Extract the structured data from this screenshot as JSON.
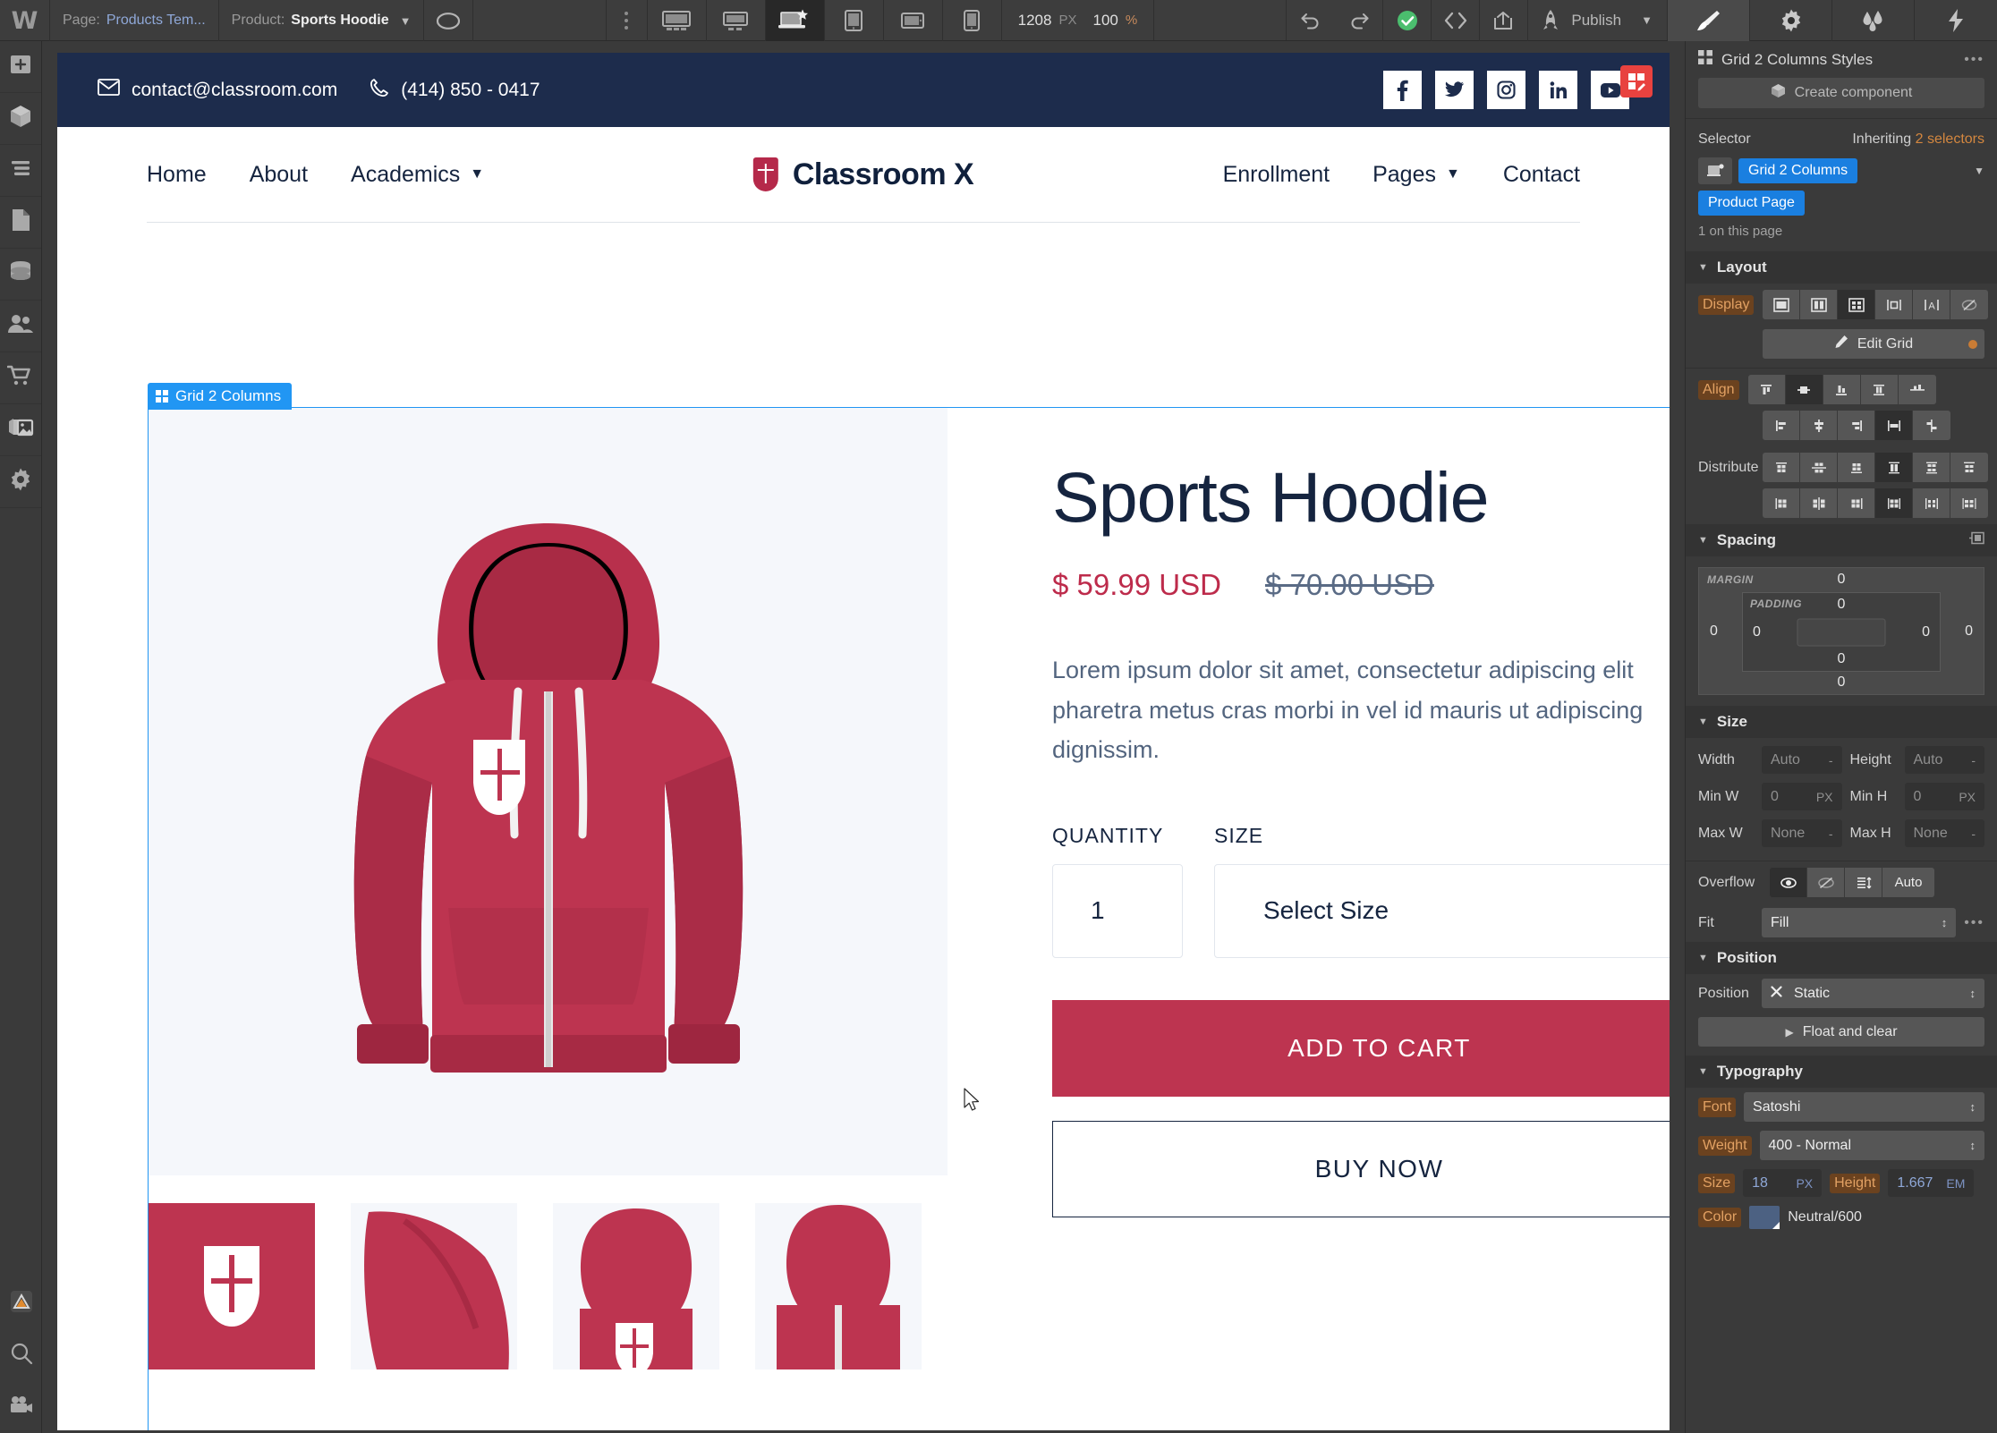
{
  "topbar": {
    "logo": "webflow-logo-icon",
    "page_label": "Page:",
    "page_value": "Products Tem...",
    "product_label": "Product:",
    "product_value": "Sports Hoodie",
    "preview_icon": "eye-preview-icon",
    "menu_icon": "kebab-menu-icon",
    "breakpoints": [
      "desktop-xl-icon",
      "desktop-icon",
      "laptop-starred-icon",
      "tablet-icon",
      "tablet-landscape-icon",
      "mobile-icon"
    ],
    "active_breakpoint_index": 2,
    "canvas_width": "1208",
    "canvas_width_unit": "PX",
    "zoom_value": "100",
    "zoom_unit": "%",
    "undo_icon": "undo-icon",
    "redo_icon": "redo-icon",
    "status_icon": "saved-check-icon",
    "code_icon": "code-brackets-icon",
    "export_icon": "share-export-icon",
    "rocket_icon": "rocket-icon",
    "publish_label": "Publish",
    "panel_tabs": [
      "paintbrush-icon",
      "gear-settings-icon",
      "interactions-drops-icon",
      "lightning-icon"
    ],
    "active_panel_tab_index": 0
  },
  "leftrail": {
    "items": [
      {
        "icon": "add-elements-icon",
        "name": "add-panel"
      },
      {
        "icon": "components-cube-icon",
        "name": "components-panel"
      },
      {
        "icon": "navigator-layers-icon",
        "name": "navigator-panel"
      },
      {
        "icon": "pages-file-icon",
        "name": "pages-panel"
      },
      {
        "icon": "cms-database-icon",
        "name": "cms-panel"
      },
      {
        "icon": "users-icon",
        "name": "users-panel"
      },
      {
        "icon": "ecommerce-cart-icon",
        "name": "ecommerce-panel"
      },
      {
        "icon": "assets-images-icon",
        "name": "assets-panel"
      },
      {
        "icon": "settings-gear-icon",
        "name": "settings-panel"
      }
    ],
    "bottom": [
      {
        "icon": "audit-warning-icon",
        "name": "audit-panel"
      },
      {
        "icon": "search-icon",
        "name": "search-panel"
      },
      {
        "icon": "video-tutorials-icon",
        "name": "video-panel"
      }
    ]
  },
  "site": {
    "topbar": {
      "email_icon": "envelope-icon",
      "email": "contact@classroom.com",
      "phone_icon": "phone-icon",
      "phone": "(414) 850 - 0417",
      "socials": [
        {
          "name": "facebook-icon",
          "glyph": "f"
        },
        {
          "name": "twitter-icon",
          "glyph": "✓"
        },
        {
          "name": "instagram-icon",
          "glyph": "□"
        },
        {
          "name": "linkedin-icon",
          "glyph": "in"
        },
        {
          "name": "youtube-icon",
          "glyph": "▶"
        }
      ]
    },
    "nav": {
      "left": [
        {
          "label": "Home",
          "dropdown": false
        },
        {
          "label": "About",
          "dropdown": false
        },
        {
          "label": "Academics",
          "dropdown": true
        }
      ],
      "brand": "Classroom X",
      "brand_icon": "shield-logo-icon",
      "right": [
        {
          "label": "Enrollment",
          "dropdown": false
        },
        {
          "label": "Pages",
          "dropdown": true
        },
        {
          "label": "Contact",
          "dropdown": false
        }
      ]
    },
    "grid_badge": "Grid 2 Columns",
    "product": {
      "title": "Sports Hoodie",
      "price": "$ 59.99 USD",
      "compare_price": "$ 70.00 USD",
      "description": "Lorem ipsum dolor sit amet, consectetur adipiscing elit pharetra metus cras morbi in vel id mauris ut adipiscing dignissim.",
      "quantity_label": "QUANTITY",
      "quantity_value": "1",
      "size_label": "SIZE",
      "size_value": "Select Size",
      "add_to_cart": "ADD TO CART",
      "buy_now": "BUY NOW",
      "accent_color": "#bd3450",
      "thumbnail_count": 4
    }
  },
  "stylepanel": {
    "header_icon": "grid-styles-icon",
    "header_title": "Grid 2 Columns Styles",
    "header_more": "•••",
    "create_component_icon": "component-cube-icon",
    "create_component": "Create component",
    "selector_label": "Selector",
    "inheriting_prefix": "Inheriting ",
    "inheriting_value": "2 selectors",
    "selector_state_icon": "selector-state-icon",
    "selector_chip": "Grid 2 Columns",
    "selector_parent_chip": "Product Page",
    "selector_count": "1 on this page",
    "layout": {
      "title": "Layout",
      "display_label": "Display",
      "display_options": [
        "display-block-icon",
        "display-flex-icon",
        "display-grid-icon",
        "display-inline-block-icon",
        "display-inline-icon",
        "display-none-icon"
      ],
      "display_active_index": 2,
      "edit_grid": "Edit Grid",
      "align_label": "Align",
      "align_row1": [
        "align-start-icon",
        "align-center-icon",
        "align-end-icon",
        "align-stretch-icon",
        "align-baseline-icon"
      ],
      "align_row1_active": 1,
      "align_row2": [
        "justify-start-icon",
        "justify-center-icon",
        "justify-end-icon",
        "justify-stretch-icon",
        "justify-baseline-icon"
      ],
      "align_row2_active": 3,
      "distribute_label": "Distribute",
      "distribute_row1": [
        "dist-top-icon",
        "dist-middle-icon",
        "dist-bottom-icon",
        "dist-stretch-icon",
        "dist-between-icon",
        "dist-around-icon"
      ],
      "distribute_row1_active": 3,
      "distribute_row2": [
        "dist-left-icon",
        "dist-center-icon",
        "dist-right-icon",
        "dist-fill-icon",
        "dist-space-between-icon",
        "dist-space-around-icon"
      ],
      "distribute_row2_active": 3
    },
    "spacing": {
      "title": "Spacing",
      "link_icon": "spacing-link-icon",
      "margin_label": "MARGIN",
      "padding_label": "PADDING",
      "margin_top": "0",
      "margin_right": "0",
      "margin_bottom": "0",
      "margin_left": "0",
      "padding_top": "0",
      "padding_right": "0",
      "padding_bottom": "0",
      "padding_left": "0"
    },
    "size": {
      "title": "Size",
      "width_label": "Width",
      "width_value": "Auto",
      "width_unit": "-",
      "height_label": "Height",
      "height_value": "Auto",
      "height_unit": "-",
      "minw_label": "Min W",
      "minw_value": "0",
      "minw_unit": "PX",
      "minh_label": "Min H",
      "minh_value": "0",
      "minh_unit": "PX",
      "maxw_label": "Max W",
      "maxw_value": "None",
      "maxw_unit": "-",
      "maxh_label": "Max H",
      "maxh_value": "None",
      "maxh_unit": "-",
      "overflow_label": "Overflow",
      "overflow_options": [
        "overflow-visible-icon",
        "overflow-hidden-icon",
        "overflow-scroll-icon"
      ],
      "overflow_auto_label": "Auto",
      "overflow_active_index": 0,
      "fit_label": "Fit",
      "fit_value": "Fill",
      "fit_more": "•••"
    },
    "position": {
      "title": "Position",
      "position_label": "Position",
      "position_clear_icon": "clear-x-icon",
      "position_value": "Static",
      "float_clear": "Float and clear",
      "float_caret": "▶"
    },
    "typography": {
      "title": "Typography",
      "font_label": "Font",
      "font_value": "Satoshi",
      "weight_label": "Weight",
      "weight_value": "400 - Normal",
      "size_label": "Size",
      "size_value": "18",
      "size_unit": "PX",
      "height_label": "Height",
      "height_value": "1.667",
      "height_unit": "EM",
      "color_label": "Color",
      "color_value": "Neutral/600",
      "color_hex": "#4c6182"
    }
  }
}
